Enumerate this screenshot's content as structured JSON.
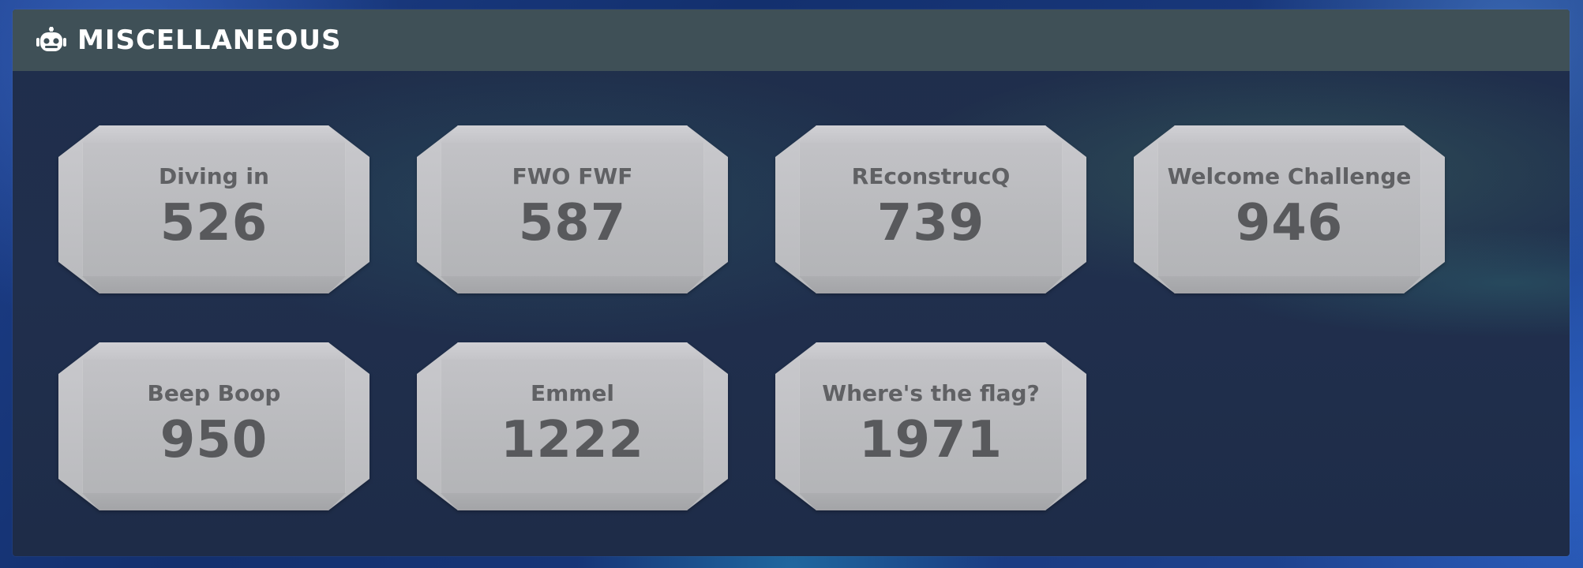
{
  "header": {
    "title": "MISCELLANEOUS",
    "icon": "robot-icon"
  },
  "challenges": [
    {
      "name": "Diving in",
      "points": "526"
    },
    {
      "name": "FWO FWF",
      "points": "587"
    },
    {
      "name": "REconstrucQ",
      "points": "739"
    },
    {
      "name": "Welcome Challenge",
      "points": "946"
    },
    {
      "name": "Beep Boop",
      "points": "950"
    },
    {
      "name": "Emmel",
      "points": "1222"
    },
    {
      "name": "Where's the flag?",
      "points": "1971"
    }
  ],
  "colors": {
    "header_bg": "#3f5057",
    "panel_bg": "#202f4d",
    "card_bg": "#bebfc2",
    "card_text": "#5c5d60"
  }
}
